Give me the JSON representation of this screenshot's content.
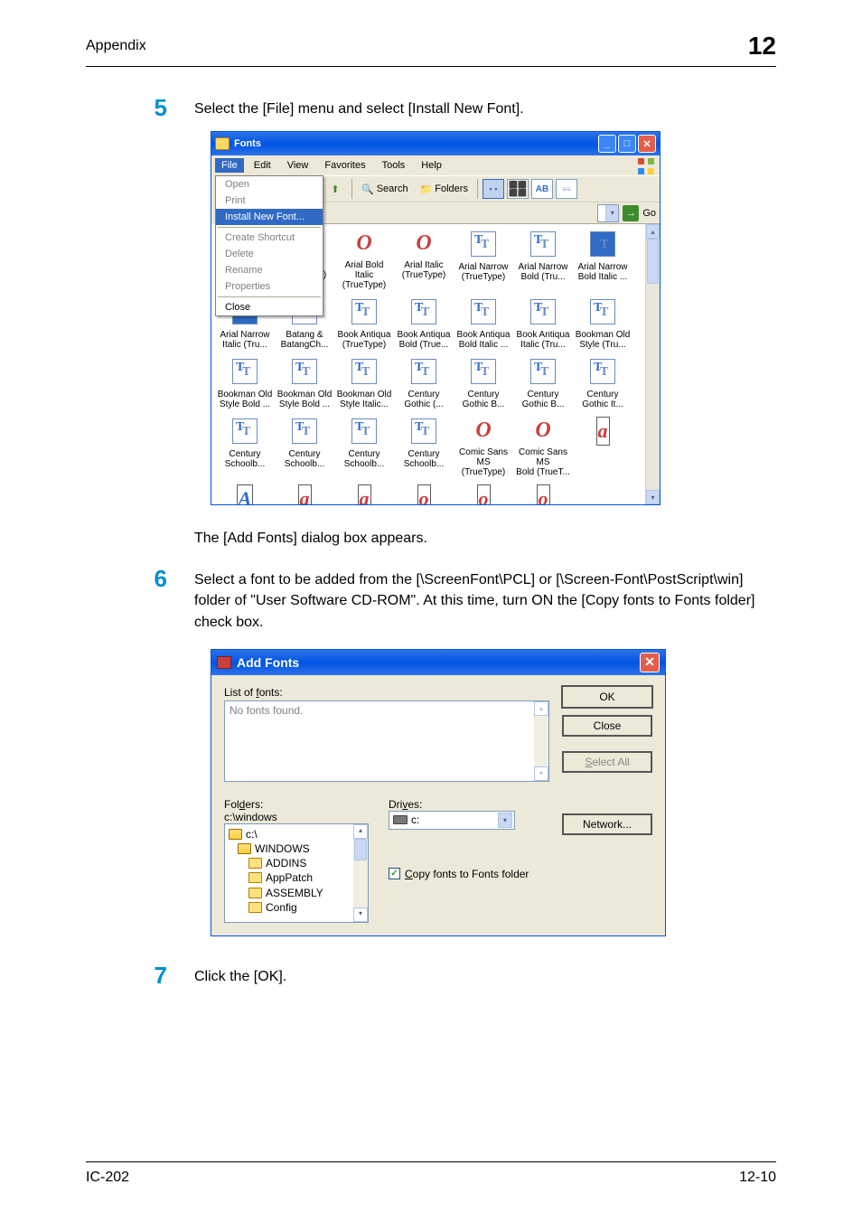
{
  "header": {
    "title": "Appendix",
    "chapter": "12"
  },
  "steps": {
    "s5": {
      "num": "5",
      "text": "Select the [File] menu and select [Install New Font]."
    },
    "s5_after": "The [Add Fonts] dialog box appears.",
    "s6": {
      "num": "6",
      "text": "Select a font to be added from the [\\ScreenFont\\PCL] or [\\Screen-Font\\PostScript\\win] folder of \"User Software CD-ROM\". At this time, turn ON the [Copy fonts to Fonts folder] check box."
    },
    "s7": {
      "num": "7",
      "text": "Click the [OK]."
    }
  },
  "fonts_window": {
    "title": "Fonts",
    "menu": {
      "file": "File",
      "edit": "Edit",
      "view": "View",
      "favorites": "Favorites",
      "tools": "Tools",
      "help": "Help"
    },
    "file_menu": {
      "open": "Open",
      "print": "Print",
      "install": "Install New Font...",
      "shortcut": "Create Shortcut",
      "delete": "Delete",
      "rename": "Rename",
      "properties": "Properties",
      "close": "Close"
    },
    "toolbar": {
      "search": "Search",
      "folders": "Folders",
      "go": "Go"
    },
    "items": [
      {
        "kind": "o",
        "l1": "",
        "l2": ")"
      },
      {
        "kind": "o",
        "l1": "Arial Bold",
        "l2": "(TrueType)"
      },
      {
        "kind": "o",
        "l1": "Arial Bold Italic",
        "l2": "(TrueType)"
      },
      {
        "kind": "o",
        "l1": "Arial Italic",
        "l2": "(TrueType)"
      },
      {
        "kind": "t",
        "l1": "Arial Narrow",
        "l2": "(TrueType)"
      },
      {
        "kind": "t",
        "l1": "Arial Narrow",
        "l2": "Bold (Tru..."
      },
      {
        "kind": "tsel",
        "l1": "Arial Narrow",
        "l2": "Bold Italic ..."
      },
      {
        "kind": "tsel",
        "l1": "Arial Narrow",
        "l2": "Italic (Tru..."
      },
      {
        "kind": "t",
        "l1": "Batang &",
        "l2": "BatangCh..."
      },
      {
        "kind": "t",
        "l1": "Book Antiqua",
        "l2": "(TrueType)"
      },
      {
        "kind": "t",
        "l1": "Book Antiqua",
        "l2": "Bold (True..."
      },
      {
        "kind": "t",
        "l1": "Book Antiqua",
        "l2": "Bold Italic ..."
      },
      {
        "kind": "t",
        "l1": "Book Antiqua",
        "l2": "Italic (Tru..."
      },
      {
        "kind": "t",
        "l1": "Bookman Old",
        "l2": "Style (Tru..."
      },
      {
        "kind": "t",
        "l1": "Bookman Old",
        "l2": "Style Bold ..."
      },
      {
        "kind": "t",
        "l1": "Bookman Old",
        "l2": "Style Bold ..."
      },
      {
        "kind": "t",
        "l1": "Bookman Old",
        "l2": "Style Italic..."
      },
      {
        "kind": "t",
        "l1": "Century",
        "l2": "Gothic (..."
      },
      {
        "kind": "t",
        "l1": "Century",
        "l2": "Gothic B..."
      },
      {
        "kind": "t",
        "l1": "Century",
        "l2": "Gothic B..."
      },
      {
        "kind": "t",
        "l1": "Century",
        "l2": "Gothic It..."
      },
      {
        "kind": "t",
        "l1": "Century",
        "l2": "Schoolb..."
      },
      {
        "kind": "t",
        "l1": "Century",
        "l2": "Schoolb..."
      },
      {
        "kind": "t",
        "l1": "Century",
        "l2": "Schoolb..."
      },
      {
        "kind": "t",
        "l1": "Century",
        "l2": "Schoolb..."
      },
      {
        "kind": "o",
        "l1": "Comic Sans MS",
        "l2": "(TrueType)"
      },
      {
        "kind": "o",
        "l1": "Comic Sans MS",
        "l2": "Bold (TrueT..."
      },
      {
        "kind": "ar",
        "l1": "",
        "l2": ""
      },
      {
        "kind": "ab",
        "l1": "",
        "l2": ""
      },
      {
        "kind": "ar",
        "l1": "",
        "l2": ""
      },
      {
        "kind": "ar",
        "l1": "",
        "l2": ""
      },
      {
        "kind": "or",
        "l1": "",
        "l2": ""
      },
      {
        "kind": "or",
        "l1": "",
        "l2": ""
      },
      {
        "kind": "or",
        "l1": "",
        "l2": ""
      }
    ]
  },
  "addfonts": {
    "title": "Add Fonts",
    "labels": {
      "listoffonts_pre": "List of ",
      "listoffonts_u": "f",
      "listoffonts_post": "onts:",
      "nofontsfound": "No fonts found.",
      "folders_pre": "Fol",
      "folders_u": "d",
      "folders_post": "ers:",
      "path": "c:\\windows",
      "drives_pre": "Dri",
      "drives_u": "v",
      "drives_post": "es:",
      "drive_c": "c:",
      "copy_u": "C",
      "copy_post": "opy fonts to Fonts folder"
    },
    "folders": {
      "root": "c:\\",
      "windows": "WINDOWS",
      "addins": "ADDINS",
      "apppatch": "AppPatch",
      "assembly": "ASSEMBLY",
      "config": "Config"
    },
    "buttons": {
      "ok": "OK",
      "close": "Close",
      "selectall_u": "S",
      "selectall_post": "elect All",
      "network": "Network..."
    }
  },
  "footer": {
    "left": "IC-202",
    "right": "12-10"
  }
}
